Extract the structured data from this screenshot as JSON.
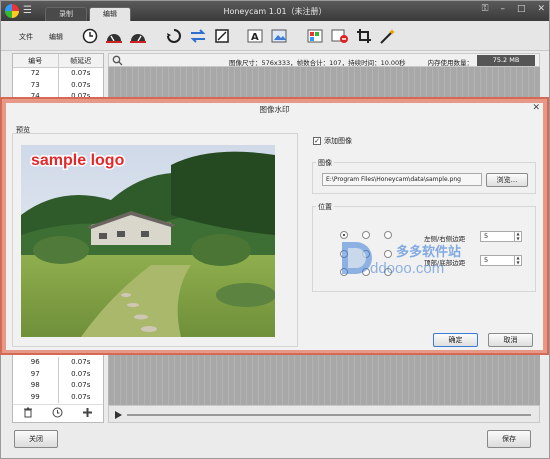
{
  "window": {
    "title": "Honeycam 1.01（未注册）",
    "tabs": [
      "录制",
      "编辑"
    ],
    "active_tab": 1
  },
  "toolbar": {
    "file_label": "文件",
    "edit_label": "编辑",
    "icons": [
      "clock-icon",
      "speed-slow-icon",
      "speed-fast-icon",
      "reverse-icon",
      "sync-icon",
      "crop-square-icon",
      "text-icon",
      "text-image-icon",
      "frame-effects-icon",
      "delete-frames-icon",
      "crop-icon",
      "magic-wand-icon"
    ]
  },
  "frame_list": {
    "headers": [
      "编号",
      "帧延迟"
    ],
    "rows_top": [
      {
        "num": "72",
        "delay": "0.07s"
      },
      {
        "num": "73",
        "delay": "0.07s"
      },
      {
        "num": "74",
        "delay": "0.07s"
      }
    ],
    "rows_bottom": [
      {
        "num": "96",
        "delay": "0.07s"
      },
      {
        "num": "97",
        "delay": "0.07s"
      },
      {
        "num": "98",
        "delay": "0.07s"
      },
      {
        "num": "99",
        "delay": "0.07s"
      }
    ]
  },
  "info_bar": {
    "text": "图像尺寸：576x333，帧数合计：107，持续时间：10.00秒",
    "memory_label": "内存使用数量：",
    "memory_value": "75.2 MB"
  },
  "bottom": {
    "close_label": "关闭",
    "save_label": "保存"
  },
  "dialog": {
    "title": "图像水印",
    "preview_label": "预览",
    "watermark_text": "sample logo",
    "add_image_label": "添加图像",
    "add_image_checked": true,
    "image_group_label": "图像",
    "image_path": "E:\\Program Files\\Honeycam\\data\\sample.png",
    "browse_label": "浏览...",
    "position_group_label": "位置",
    "h_margin_label": "左侧/右侧边距",
    "h_margin_value": "5",
    "v_margin_label": "顶部/底部边距",
    "v_margin_value": "5",
    "selected_position": 0,
    "ok_label": "确定",
    "cancel_label": "取消"
  },
  "overlay_watermark": {
    "cn": "多多软件站",
    "en": "ddooo.com",
    "color": "#3a7bd5"
  }
}
